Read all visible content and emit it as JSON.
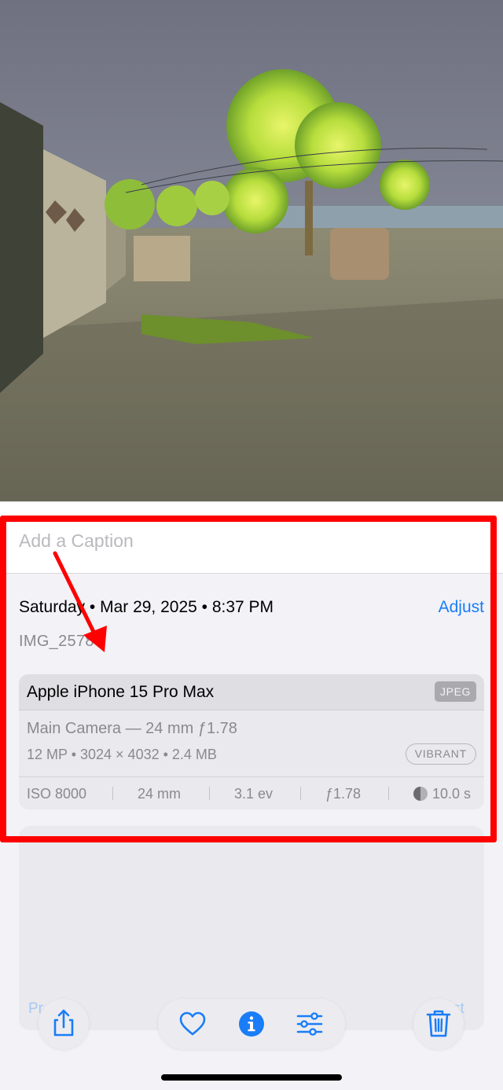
{
  "caption": {
    "placeholder": "Add a Caption"
  },
  "info": {
    "date_time": "Saturday • Mar 29, 2025 • 8:37 PM",
    "adjust_label": "Adjust",
    "filename": "IMG_2578",
    "exif": {
      "device": "Apple iPhone 15 Pro Max",
      "format": "JPEG",
      "lens": "Main Camera — 24 mm ƒ1.78",
      "resolution": "12 MP • 3024 × 4032 • 2.4 MB",
      "style": "VIBRANT",
      "iso": "ISO 8000",
      "focal_length": "24 mm",
      "exposure": "3.1 ev",
      "aperture": "ƒ1.78",
      "shutter": "10.0 s"
    }
  },
  "toolbar": {
    "prev_hint": "Pr",
    "next_hint": "st",
    "icons": [
      "share-icon",
      "heart-icon",
      "info-icon",
      "adjust-sliders-icon",
      "trash-icon"
    ]
  },
  "colors": {
    "accent": "#1a7df7",
    "annotation": "#ff0000",
    "background": "#f2f2f7"
  }
}
